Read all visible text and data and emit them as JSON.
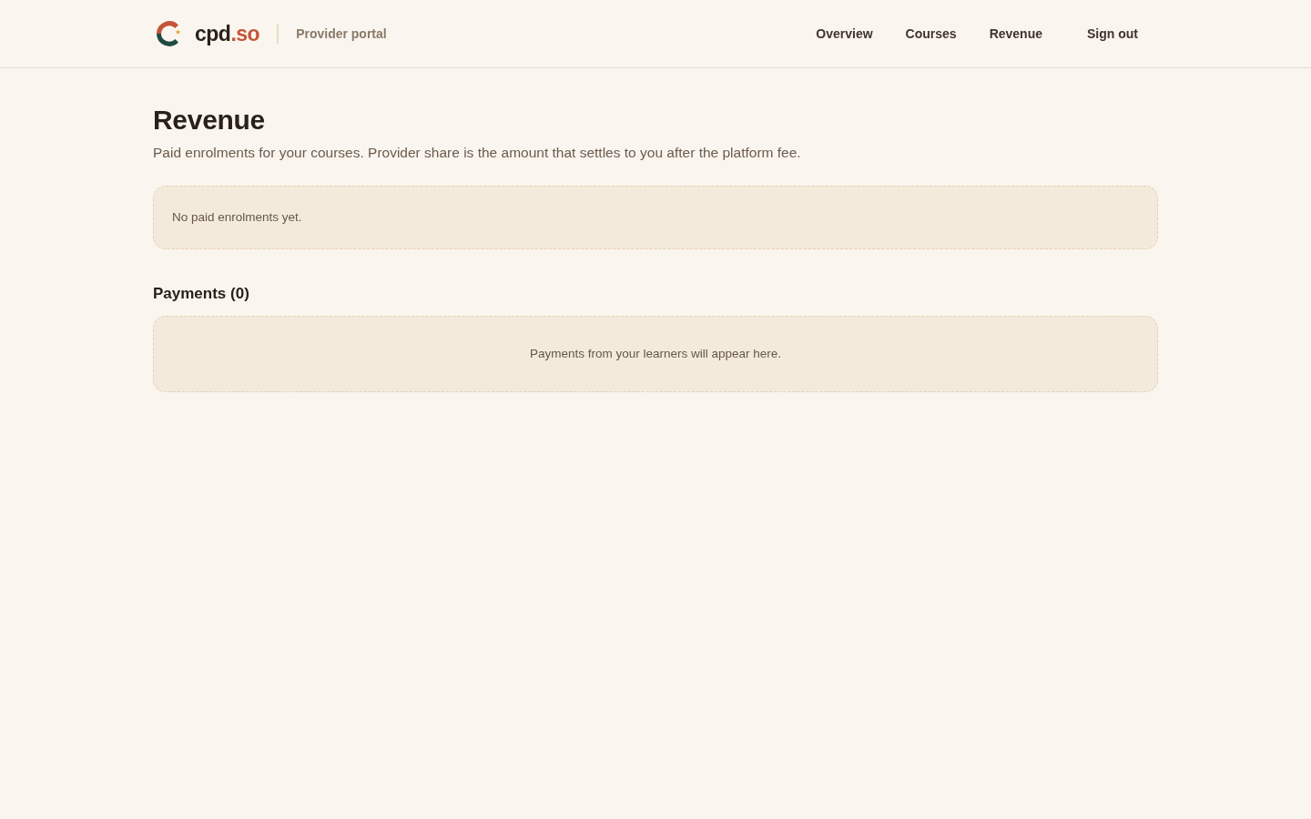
{
  "header": {
    "brand": {
      "name": "cpd",
      "suffix": ".so"
    },
    "portal_label": "Provider portal",
    "nav": [
      {
        "label": "Overview"
      },
      {
        "label": "Courses"
      },
      {
        "label": "Revenue"
      }
    ],
    "sign_out": "Sign out"
  },
  "page": {
    "title": "Revenue",
    "description": "Paid enrolments for your courses. Provider share is the amount that settles to you after the platform fee."
  },
  "summary": {
    "empty_message": "No paid enrolments yet."
  },
  "payments": {
    "title": "Payments (0)",
    "empty_message": "Payments from your learners will appear here."
  }
}
